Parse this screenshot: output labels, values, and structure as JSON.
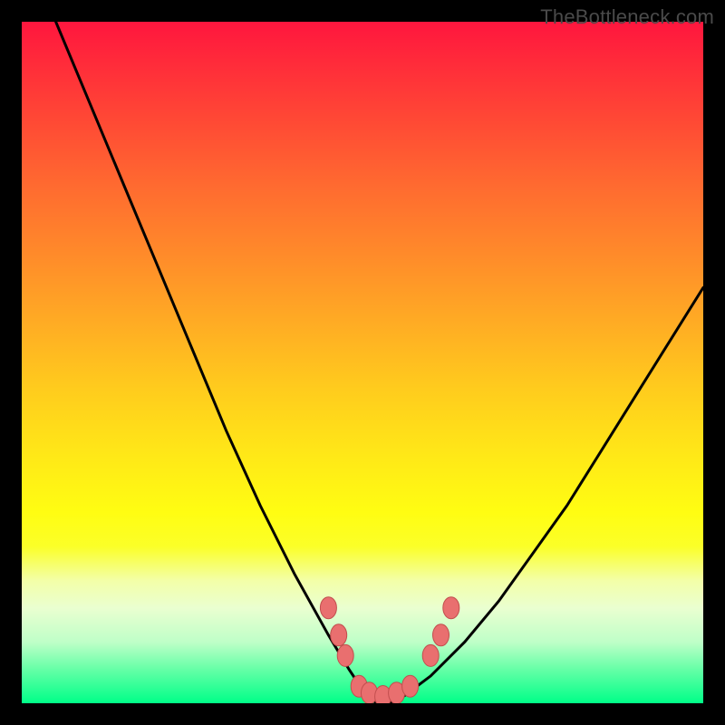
{
  "watermark": "TheBottleneck.com",
  "chart_data": {
    "type": "line",
    "title": "",
    "xlabel": "",
    "ylabel": "",
    "xlim": [
      0,
      100
    ],
    "ylim": [
      0,
      100
    ],
    "series": [
      {
        "name": "bottleneck-curve",
        "x": [
          5,
          10,
          15,
          20,
          25,
          30,
          35,
          40,
          45,
          48,
          50,
          52,
          54,
          56,
          60,
          65,
          70,
          75,
          80,
          85,
          90,
          95,
          100
        ],
        "y": [
          100,
          88,
          76,
          64,
          52,
          40,
          29,
          19,
          10,
          5,
          2,
          0,
          0,
          1,
          4,
          9,
          15,
          22,
          29,
          37,
          45,
          53,
          61
        ]
      }
    ],
    "markers": [
      {
        "name": "left-edge-marker",
        "x": 45.0,
        "y": 14
      },
      {
        "name": "left-upper-marker",
        "x": 46.5,
        "y": 10
      },
      {
        "name": "left-lower-marker",
        "x": 47.5,
        "y": 7
      },
      {
        "name": "valley-marker-1",
        "x": 49.5,
        "y": 2.5
      },
      {
        "name": "valley-marker-2",
        "x": 51.0,
        "y": 1.5
      },
      {
        "name": "valley-marker-3",
        "x": 53.0,
        "y": 1.0
      },
      {
        "name": "valley-marker-4",
        "x": 55.0,
        "y": 1.5
      },
      {
        "name": "valley-marker-5",
        "x": 57.0,
        "y": 2.5
      },
      {
        "name": "right-lower-marker",
        "x": 60.0,
        "y": 7
      },
      {
        "name": "right-upper-marker",
        "x": 61.5,
        "y": 10
      },
      {
        "name": "right-edge-marker",
        "x": 63.0,
        "y": 14
      }
    ],
    "colors": {
      "curve": "#000000",
      "marker_fill": "#e96f6f",
      "marker_stroke": "#c24e4e"
    }
  }
}
